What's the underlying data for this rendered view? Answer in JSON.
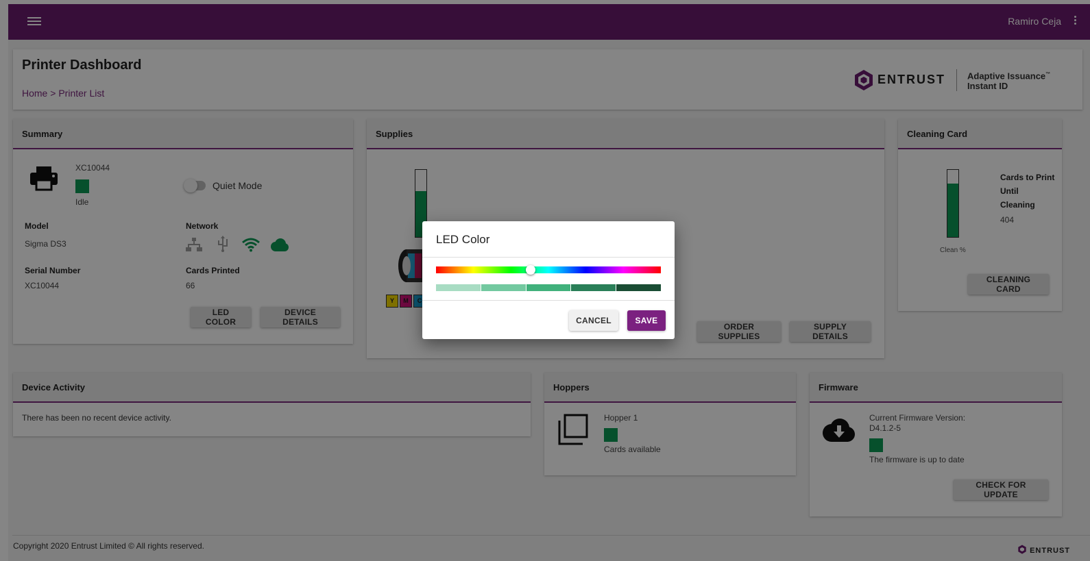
{
  "header": {
    "user_name": "Ramiro Ceja"
  },
  "page": {
    "title": "Printer Dashboard",
    "breadcrumb": [
      "Home",
      ">",
      "Printer List"
    ]
  },
  "brand": {
    "company": "ENTRUST",
    "product_line1": "Adaptive Issuance",
    "product_tm": "™",
    "product_line2": "Instant ID",
    "accent_color": "#6a1b6e",
    "status_color": "#0d9a55"
  },
  "summary": {
    "title": "Summary",
    "printer_name": "XC10044",
    "status": "Idle",
    "quiet_mode_label": "Quiet Mode",
    "quiet_mode_on": false,
    "model_label": "Model",
    "model": "Sigma DS3",
    "network_label": "Network",
    "network_icons": [
      "ethernet-icon",
      "usb-icon",
      "wifi-icon",
      "cloud-icon"
    ],
    "serial_label": "Serial Number",
    "serial": "XC10044",
    "cards_printed_label": "Cards Printed",
    "cards_printed": "66",
    "led_color_button": "LED COLOR",
    "device_details_button": "DEVICE DETAILS"
  },
  "supplies": {
    "title": "Supplies",
    "ribbon_level": 0.68,
    "ribbon_panels": [
      "Y",
      "M",
      "C"
    ],
    "order_button": "ORDER SUPPLIES",
    "details_button": "SUPPLY DETAILS"
  },
  "cleaning": {
    "title": "Cleaning Card",
    "level": 0.8,
    "gauge_label": "Clean %",
    "cards_until_label_1": "Cards to Print",
    "cards_until_label_2": "Until",
    "cards_until_label_3": "Cleaning",
    "cards_until_value": "404",
    "button": "CLEANING CARD"
  },
  "activity": {
    "title": "Device Activity",
    "message": "There has been no recent device activity."
  },
  "hoppers": {
    "title": "Hoppers",
    "name": "Hopper 1",
    "status": "Cards available"
  },
  "firmware": {
    "title": "Firmware",
    "current_label": "Current Firmware Version:",
    "version": "D4.1.2-5",
    "status": "The firmware is up to date",
    "button": "CHECK FOR UPDATE"
  },
  "dialog": {
    "title": "LED Color",
    "hue_fraction": 0.42,
    "shades": [
      "#a8dcc3",
      "#73c9a0",
      "#41b17c",
      "#2a7f58",
      "#1a4d34"
    ],
    "cancel_button": "CANCEL",
    "save_button": "SAVE"
  },
  "footer": {
    "copyright": "Copyright 2020 Entrust Limited © All rights reserved.",
    "logo_text": "ENTRUST"
  }
}
